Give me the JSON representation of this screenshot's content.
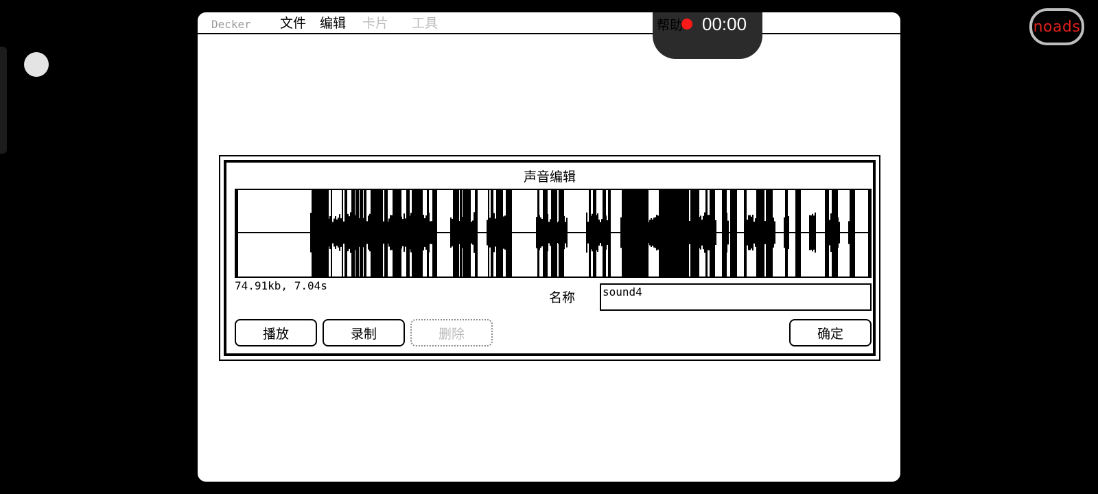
{
  "menubar": {
    "app_name": "Decker",
    "items": [
      {
        "label": "文件",
        "enabled": true
      },
      {
        "label": "编辑",
        "enabled": true
      },
      {
        "label": "卡片",
        "enabled": false
      },
      {
        "label": "工具",
        "enabled": false
      }
    ],
    "help_label": "帮助"
  },
  "recorder": {
    "time": "00:00",
    "dot_color": "#ff1a1a"
  },
  "overlay": {
    "noads_label": "noads",
    "noads_color": "#e0201c"
  },
  "dialog": {
    "title": "声音编辑",
    "info": "74.91kb, 7.04s",
    "name_label": "名称",
    "name_value": "sound4",
    "buttons": {
      "play": "播放",
      "record": "录制",
      "delete": "删除",
      "ok": "确定"
    }
  }
}
